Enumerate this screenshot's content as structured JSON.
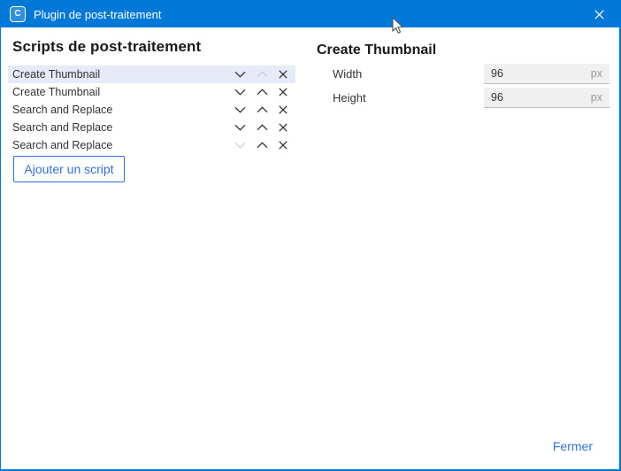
{
  "window": {
    "title": "Plugin de post-traitement",
    "app_icon_letter": "C"
  },
  "left_panel": {
    "heading": "Scripts de post-traitement",
    "scripts": [
      {
        "label": "Create Thumbnail",
        "selected": true,
        "can_move_down": true,
        "can_move_up": false,
        "can_remove": true
      },
      {
        "label": "Create Thumbnail",
        "selected": false,
        "can_move_down": true,
        "can_move_up": true,
        "can_remove": true
      },
      {
        "label": "Search and Replace",
        "selected": false,
        "can_move_down": true,
        "can_move_up": true,
        "can_remove": true
      },
      {
        "label": "Search and Replace",
        "selected": false,
        "can_move_down": true,
        "can_move_up": true,
        "can_remove": true
      },
      {
        "label": "Search and Replace",
        "selected": false,
        "can_move_down": false,
        "can_move_up": true,
        "can_remove": true
      }
    ],
    "add_button_label": "Ajouter un script"
  },
  "settings_panel": {
    "heading": "Create Thumbnail",
    "fields": [
      {
        "label": "Width",
        "value": "96",
        "unit": "px"
      },
      {
        "label": "Height",
        "value": "96",
        "unit": "px"
      }
    ]
  },
  "footer": {
    "close_label": "Fermer"
  },
  "colors": {
    "titlebar": "#0078d7",
    "accent": "#2f6fde",
    "selected_row": "#e7ebf7",
    "field_bg": "#f0f0f0",
    "unit_text": "#9a9a9a"
  }
}
